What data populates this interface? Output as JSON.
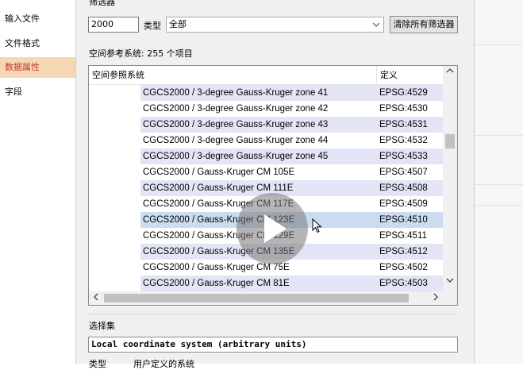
{
  "sidebar": {
    "items": [
      {
        "label": "输入文件",
        "active": false
      },
      {
        "label": "文件格式",
        "active": false
      },
      {
        "label": "数据属性",
        "active": true
      },
      {
        "label": "字段",
        "active": false
      }
    ]
  },
  "filter": {
    "group_label": "筛选器",
    "value": "2000",
    "type_label": "类型",
    "type_value": "全部",
    "clear_button": "清除所有筛选器"
  },
  "crs_list": {
    "count_label": "空间参考系统:  255 个项目",
    "columns": [
      "空间参照系统",
      "定义"
    ],
    "rows": [
      {
        "name": "CGCS2000 / 3-degree Gauss-Kruger zone 41",
        "code": "EPSG:4529"
      },
      {
        "name": "CGCS2000 / 3-degree Gauss-Kruger zone 42",
        "code": "EPSG:4530"
      },
      {
        "name": "CGCS2000 / 3-degree Gauss-Kruger zone 43",
        "code": "EPSG:4531"
      },
      {
        "name": "CGCS2000 / 3-degree Gauss-Kruger zone 44",
        "code": "EPSG:4532"
      },
      {
        "name": "CGCS2000 / 3-degree Gauss-Kruger zone 45",
        "code": "EPSG:4533"
      },
      {
        "name": "CGCS2000 / Gauss-Kruger CM 105E",
        "code": "EPSG:4507"
      },
      {
        "name": "CGCS2000 / Gauss-Kruger CM 111E",
        "code": "EPSG:4508"
      },
      {
        "name": "CGCS2000 / Gauss-Kruger CM 117E",
        "code": "EPSG:4509"
      },
      {
        "name": "CGCS2000 / Gauss-Kruger CM 123E",
        "code": "EPSG:4510"
      },
      {
        "name": "CGCS2000 / Gauss-Kruger CM 129E",
        "code": "EPSG:4511"
      },
      {
        "name": "CGCS2000 / Gauss-Kruger CM 135E",
        "code": "EPSG:4512"
      },
      {
        "name": "CGCS2000 / Gauss-Kruger CM 75E",
        "code": "EPSG:4502"
      },
      {
        "name": "CGCS2000 / Gauss-Kruger CM 81E",
        "code": "EPSG:4503"
      }
    ],
    "selected_row": "CGCS2000 / Gauss-Kruger CM 123E"
  },
  "selection": {
    "group_label": "选择集",
    "value": "Local coordinate system (arbitrary units)",
    "type_label": "类型",
    "type_value": "用户定义的系统"
  },
  "icons": {
    "dropdown": "chevron-down-icon",
    "scroll_up": "scroll-up-icon",
    "scroll_down": "scroll-down-icon",
    "scroll_left": "scroll-left-icon",
    "scroll_right": "scroll-right-icon",
    "video": "play-icon",
    "pointer": "mouse-cursor-icon"
  },
  "colors": {
    "active_nav_bg": "#f5d7b4",
    "active_nav_text": "#c0392b",
    "alt_row": "#e3e5f6",
    "selected_row": "#cbdcf0"
  }
}
